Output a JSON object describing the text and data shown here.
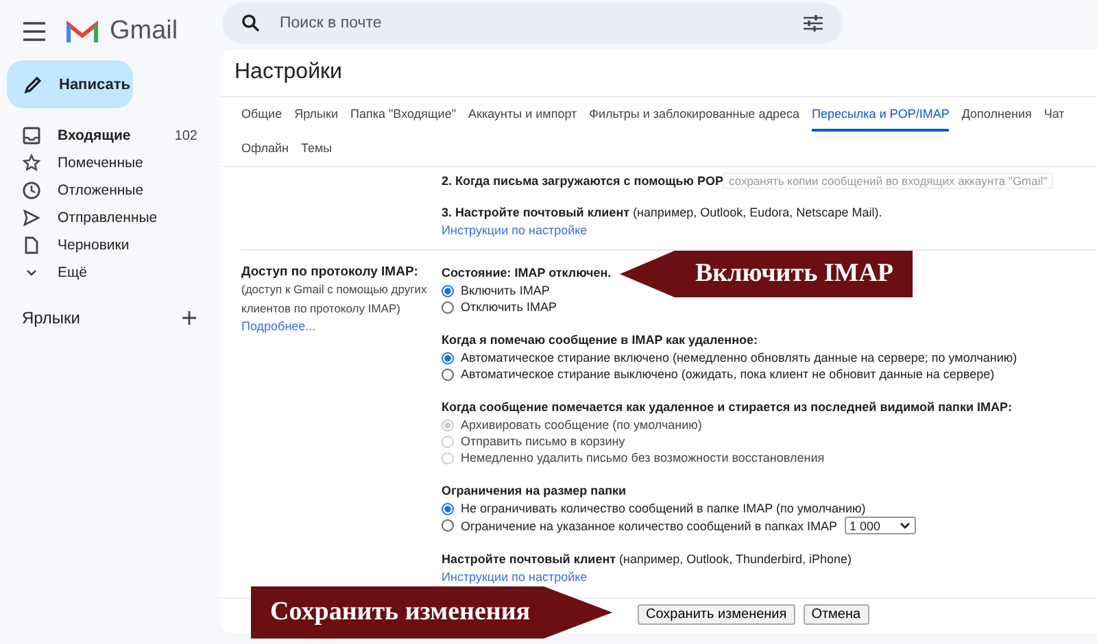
{
  "app": {
    "name": "Gmail"
  },
  "search": {
    "placeholder": "Поиск в почте"
  },
  "compose": {
    "label": "Написать"
  },
  "nav": [
    {
      "label": "Входящие",
      "count": "102",
      "unread": true
    },
    {
      "label": "Помеченные",
      "unread": false
    },
    {
      "label": "Отложенные",
      "unread": false
    },
    {
      "label": "Отправленные",
      "unread": false
    },
    {
      "label": "Черновики",
      "unread": false
    },
    {
      "label": "Ещё",
      "unread": false
    }
  ],
  "labels_heading": "Ярлыки",
  "page_title": "Настройки",
  "tabs": [
    [
      {
        "label": "Общие",
        "selected": false
      },
      {
        "label": "Ярлыки",
        "selected": false
      },
      {
        "label": "Папка \"Входящие\"",
        "selected": false
      },
      {
        "label": "Аккаунты и импорт",
        "selected": false
      },
      {
        "label": "Фильтры и заблокированные адреса",
        "selected": false
      },
      {
        "label": "Пересылка и POP/IMAP",
        "selected": true
      },
      {
        "label": "Дополнения",
        "selected": false
      },
      {
        "label": "Чат",
        "selected": false
      }
    ],
    [
      {
        "label": "Офлайн",
        "selected": false
      },
      {
        "label": "Темы",
        "selected": false
      }
    ]
  ],
  "pop": {
    "step2": "2. Когда письма загружаются с помощью POP",
    "step2_field": "сохранять копии сообщений во входящих аккаунта \"Gmail\"",
    "step3": "**3. Настройте почтовый клиент** (например, Outlook, Eudora, Netscape Mail).",
    "step3_link": "Инструкции по настройке"
  },
  "imap": {
    "label": "Доступ по протоколу IMAP:",
    "note": "(доступ к Gmail с помощью других клиентов по протоколу IMAP)",
    "link": "Подробнее...",
    "groups": [
      {
        "title": "Состояние: IMAP отключен.",
        "options": [
          {
            "label": "Включить IMAP",
            "selected": true,
            "disabled": false
          },
          {
            "label": "Отключить IMAP",
            "selected": false,
            "disabled": false
          }
        ]
      },
      {
        "title": "Когда я помечаю сообщение в IMAP как удаленное:",
        "options": [
          {
            "label": "Автоматическое стирание включено (немедленно обновлять данные на сервере; по умолчанию)",
            "selected": true,
            "disabled": false
          },
          {
            "label": "Автоматическое стирание выключено (ожидать, пока клиент не обновит данные на сервере)",
            "selected": false,
            "disabled": false
          }
        ]
      },
      {
        "title": "Когда сообщение помечается как удаленное и стирается из последней видимой папки IMAP:",
        "options": [
          {
            "label": "Архивировать сообщение (по умолчанию)",
            "selected": true,
            "disabled": true
          },
          {
            "label": "Отправить письмо в корзину",
            "selected": false,
            "disabled": true
          },
          {
            "label": "Немедленно удалить письмо без возможности восстановления",
            "selected": false,
            "disabled": true
          }
        ]
      },
      {
        "title": "Ограничения на размер папки",
        "options": [
          {
            "label": "Не ограничивать количество сообщений в папке IMAP (по умолчанию)",
            "selected": true,
            "disabled": false
          },
          {
            "label": "Ограничение на указанное количество сообщений в папках IMAP",
            "selected": false,
            "disabled": false,
            "select": "1 000"
          }
        ]
      }
    ],
    "client": "**Настройте почтовый клиент** (например, Outlook, Thunderbird, iPhone)",
    "client_link": "Инструкции по настройке"
  },
  "buttons": [
    "Сохранить изменения",
    "Отмена"
  ],
  "annotations": [
    {
      "text": "Включить IMAP"
    },
    {
      "text": "Сохранить изменения"
    }
  ]
}
